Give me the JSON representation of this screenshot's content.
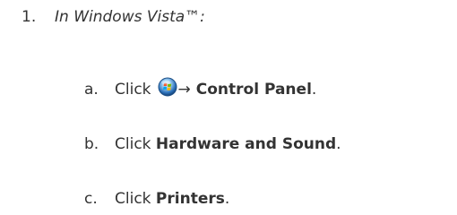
{
  "step": {
    "number": "1.",
    "title": "In Windows Vista™:"
  },
  "substeps": [
    {
      "letter": "a.",
      "prefix": "Click",
      "arrow": "→",
      "target": "Control Panel",
      "suffix": ".",
      "icon": "windows-start-orb-icon"
    },
    {
      "letter": "b.",
      "prefix": "Click",
      "target": "Hardware and Sound",
      "suffix": "."
    },
    {
      "letter": "c.",
      "prefix": "Click",
      "target": "Printers",
      "suffix": "."
    }
  ],
  "colors": {
    "text": "#333333",
    "orb_blue": "#2a6fb8",
    "orb_highlight": "#9fd0f5"
  }
}
